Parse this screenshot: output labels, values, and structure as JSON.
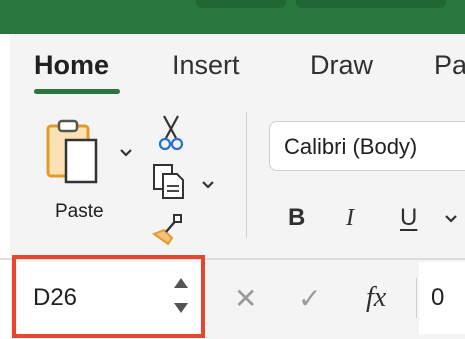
{
  "tabs": [
    {
      "label": "Home",
      "active": true
    },
    {
      "label": "Insert"
    },
    {
      "label": "Draw"
    },
    {
      "label": "Pa"
    }
  ],
  "clipboard": {
    "paste_label": "Paste"
  },
  "font": {
    "name": "Calibri (Body)"
  },
  "format": {
    "bold": "B",
    "italic": "I",
    "underline": "U"
  },
  "namebox": {
    "value": "D26"
  },
  "formula_bar": {
    "cancel_glyph": "✕",
    "enter_glyph": "✓",
    "fx_label": "fx",
    "value": "0"
  },
  "colors": {
    "accent_green": "#27773f",
    "highlight_red": "#e8452e"
  },
  "icons": [
    "paste-icon",
    "cut-icon",
    "copy-icon",
    "format-painter-icon",
    "chevron-down-icon",
    "spinner-up-icon",
    "spinner-down-icon",
    "cancel-icon",
    "enter-icon",
    "fx-icon"
  ]
}
